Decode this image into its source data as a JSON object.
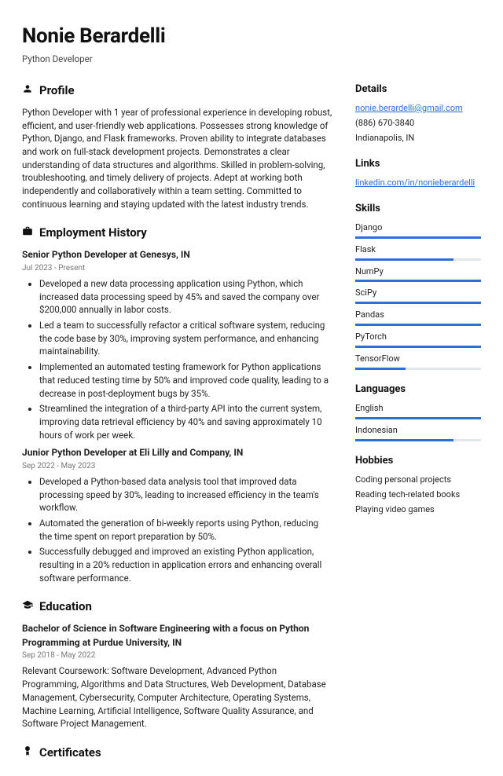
{
  "header": {
    "name": "Nonie Berardelli",
    "title": "Python Developer"
  },
  "profile": {
    "heading": "Profile",
    "text": "Python Developer with 1 year of professional experience in developing robust, efficient, and user-friendly web applications. Possesses strong knowledge of Python, Django, and Flask frameworks. Proven ability to integrate databases and work on full-stack development projects. Demonstrates a clear understanding of data structures and algorithms. Skilled in problem-solving, troubleshooting, and timely delivery of projects. Adept at working both independently and collaboratively within a team setting. Committed to continuous learning and staying updated with the latest industry trends."
  },
  "employment": {
    "heading": "Employment History",
    "jobs": [
      {
        "title": "Senior Python Developer at Genesys, IN",
        "dates": "Jul 2023 - Present",
        "bullets": [
          "Developed a new data processing application using Python, which increased data processing speed by 45% and saved the company over $200,000 annually in labor costs.",
          "Led a team to successfully refactor a critical software system, reducing the code base by 30%, improving system performance, and enhancing maintainability.",
          "Implemented an automated testing framework for Python applications that reduced testing time by 50% and improved code quality, leading to a decrease in post-deployment bugs by 35%.",
          "Streamlined the integration of a third-party API into the current system, improving data retrieval efficiency by 40% and saving approximately 10 hours of work per week."
        ]
      },
      {
        "title": "Junior Python Developer at Eli Lilly and Company, IN",
        "dates": "Sep 2022 - May 2023",
        "bullets": [
          "Developed a Python-based data analysis tool that improved data processing speed by 30%, leading to increased efficiency in the team's workflow.",
          "Automated the generation of bi-weekly reports using Python, reducing the time spent on report preparation by 50%.",
          "Successfully debugged and improved an existing Python application, resulting in a 20% reduction in application errors and enhancing overall software performance."
        ]
      }
    ]
  },
  "education": {
    "heading": "Education",
    "degree": "Bachelor of Science in Software Engineering with a focus on Python Programming at Purdue University, IN",
    "dates": "Sep 2018 - May 2022",
    "description": "Relevant Coursework: Software Development, Advanced Python Programming, Algorithms and Data Structures, Web Development, Database Management, Cybersecurity, Computer Architecture, Operating Systems, Machine Learning, Artificial Intelligence, Software Quality Assurance, and Software Project Management."
  },
  "certificates": {
    "heading": "Certificates"
  },
  "details": {
    "heading": "Details",
    "email": "nonie.berardelli@gmail.com",
    "phone": "(886) 670-3840",
    "location": "Indianapolis, IN"
  },
  "links": {
    "heading": "Links",
    "items": [
      "linkedin.com/in/nonieberardelli"
    ]
  },
  "skills": {
    "heading": "Skills",
    "items": [
      {
        "name": "Django",
        "level": 100
      },
      {
        "name": "Flask",
        "level": 78
      },
      {
        "name": "NumPy",
        "level": 100
      },
      {
        "name": "SciPy",
        "level": 100
      },
      {
        "name": "Pandas",
        "level": 100
      },
      {
        "name": "PyTorch",
        "level": 100
      },
      {
        "name": "TensorFlow",
        "level": 40
      }
    ]
  },
  "languages": {
    "heading": "Languages",
    "items": [
      {
        "name": "English",
        "level": 100
      },
      {
        "name": "Indonesian",
        "level": 78
      }
    ]
  },
  "hobbies": {
    "heading": "Hobbies",
    "items": [
      "Coding personal projects",
      "Reading tech-related books",
      "Playing video games"
    ]
  }
}
